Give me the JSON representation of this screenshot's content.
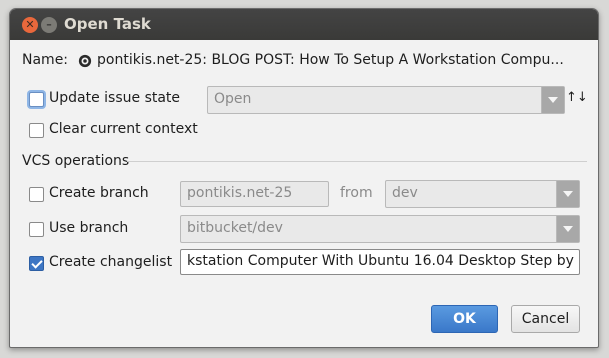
{
  "window": {
    "title": "Open Task"
  },
  "task": {
    "name_label": "Name:",
    "name_value": "pontikis.net-25: BLOG POST: How To Setup A Workstation Compu..."
  },
  "update_state": {
    "label": "Update issue state",
    "value": "Open",
    "checked": false,
    "sort_icon": "↑↓"
  },
  "clear_context": {
    "label": "Clear current context",
    "checked": false
  },
  "vcs": {
    "section_title": "VCS operations",
    "create_branch": {
      "label": "Create branch",
      "checked": false,
      "value": "pontikis.net-25",
      "from_label": "from",
      "from_value": "dev"
    },
    "use_branch": {
      "label": "Use branch",
      "checked": false,
      "value": "bitbucket/dev"
    },
    "create_changelist": {
      "label": "Create changelist",
      "checked": true,
      "value": "kstation Computer With Ubuntu 16.04 Desktop Step by ..."
    }
  },
  "buttons": {
    "ok": "OK",
    "cancel": "Cancel"
  },
  "colors": {
    "accent": "#3d76c4",
    "titlebar": "#3c3c3a",
    "close": "#e9683c"
  }
}
